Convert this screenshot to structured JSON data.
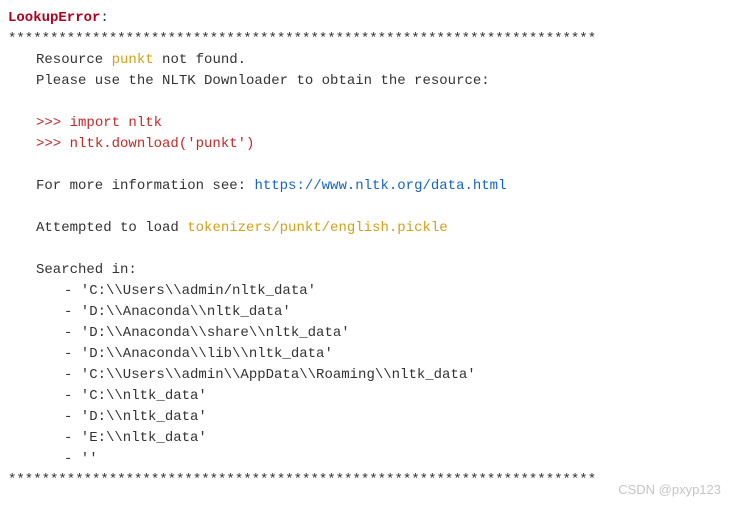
{
  "error": {
    "name": "LookupError",
    "colon": ":"
  },
  "sep": "**********************************************************************",
  "msg": {
    "resource_prefix": "Resource ",
    "resource_name": "punkt",
    "resource_suffix": " not found.",
    "please_use": "Please use the NLTK Downloader to obtain the resource:",
    "prompt1": ">>> ",
    "code1": "import nltk",
    "prompt2": ">>> ",
    "code2": "nltk.download('punkt')",
    "more_info_prefix": "For more information see: ",
    "more_info_url": "https://www.nltk.org/data.html",
    "attempted_prefix": "Attempted to load ",
    "attempted_path": "tokenizers/punkt/english.pickle",
    "searched_in": "Searched in:",
    "paths": [
      "- 'C:\\\\Users\\\\admin/nltk_data'",
      "- 'D:\\\\Anaconda\\\\nltk_data'",
      "- 'D:\\\\Anaconda\\\\share\\\\nltk_data'",
      "- 'D:\\\\Anaconda\\\\lib\\\\nltk_data'",
      "- 'C:\\\\Users\\\\admin\\\\AppData\\\\Roaming\\\\nltk_data'",
      "- 'C:\\\\nltk_data'",
      "- 'D:\\\\nltk_data'",
      "- 'E:\\\\nltk_data'",
      "- ''"
    ]
  },
  "watermark": "CSDN @pxyp123"
}
